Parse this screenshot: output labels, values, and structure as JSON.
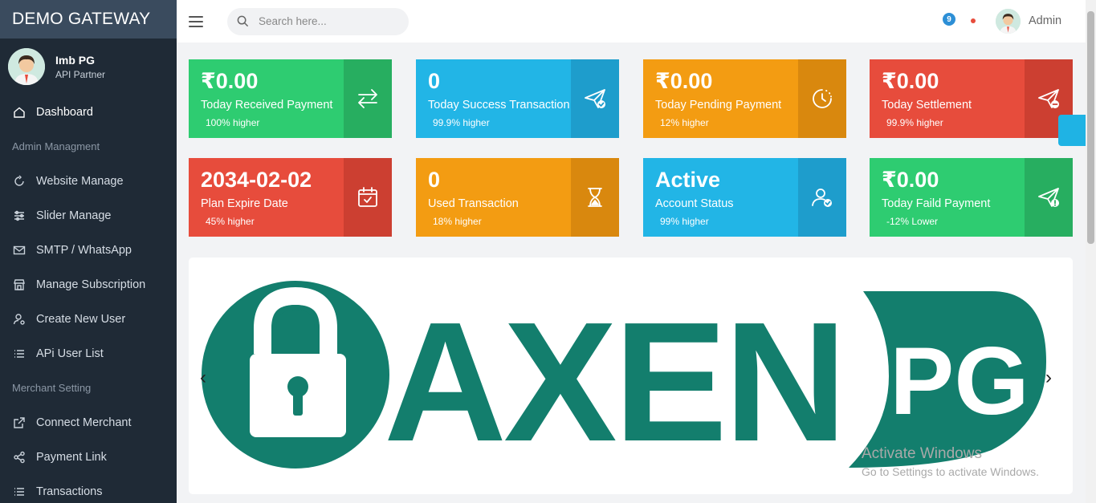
{
  "brand": "DEMO GATEWAY",
  "profile": {
    "name": "Imb PG",
    "role": "API Partner"
  },
  "nav": {
    "dashboard": "Dashboard",
    "admin_heading": "Admin Managment",
    "website": "Website Manage",
    "slider": "Slider Manage",
    "smtp": "SMTP / WhatsApp",
    "subscription": "Manage Subscription",
    "create_user": "Create New User",
    "api_users": "APi User List",
    "merchant_heading": "Merchant Setting",
    "connect": "Connect Merchant",
    "payment_link": "Payment Link",
    "transactions": "Transactions"
  },
  "topbar": {
    "search_placeholder": "Search here...",
    "notification_count": "9",
    "user": "Admin"
  },
  "cards": [
    {
      "value": "₹0.00",
      "label": "Today Received Payment",
      "trend": "100% higher",
      "color": "#2ecc71",
      "icon": "transfer-icon"
    },
    {
      "value": "0",
      "label": "Today Success Transaction",
      "trend": "99.9% higher",
      "color": "#22b5e6",
      "icon": "send-check-icon"
    },
    {
      "value": "₹0.00",
      "label": "Today Pending Payment",
      "trend": "12% higher",
      "color": "#f39c12",
      "icon": "clock-icon"
    },
    {
      "value": "₹0.00",
      "label": "Today Settlement",
      "trend": "99.9% higher",
      "color": "#e74c3c",
      "icon": "send-minus-icon"
    },
    {
      "value": "2034-02-02",
      "label": "Plan Expire Date",
      "trend": "45% higher",
      "color": "#e74c3c",
      "icon": "calendar-check-icon"
    },
    {
      "value": "0",
      "label": "Used Transaction",
      "trend": "18% higher",
      "color": "#f39c12",
      "icon": "hourglass-icon"
    },
    {
      "value": "Active",
      "label": "Account Status",
      "trend": "99% higher",
      "color": "#22b5e6",
      "icon": "user-check-icon"
    },
    {
      "value": "₹0.00",
      "label": "Today Faild Payment",
      "trend": "-12% Lower",
      "color": "#2ecc71",
      "icon": "send-alert-icon"
    }
  ],
  "banner": {
    "text_main": "AXEN",
    "text_badge": "PG",
    "prev": "‹",
    "next": "›",
    "brand_color": "#137e6d"
  },
  "watermark": {
    "line1": "Activate Windows",
    "line2": "Go to Settings to activate Windows."
  }
}
